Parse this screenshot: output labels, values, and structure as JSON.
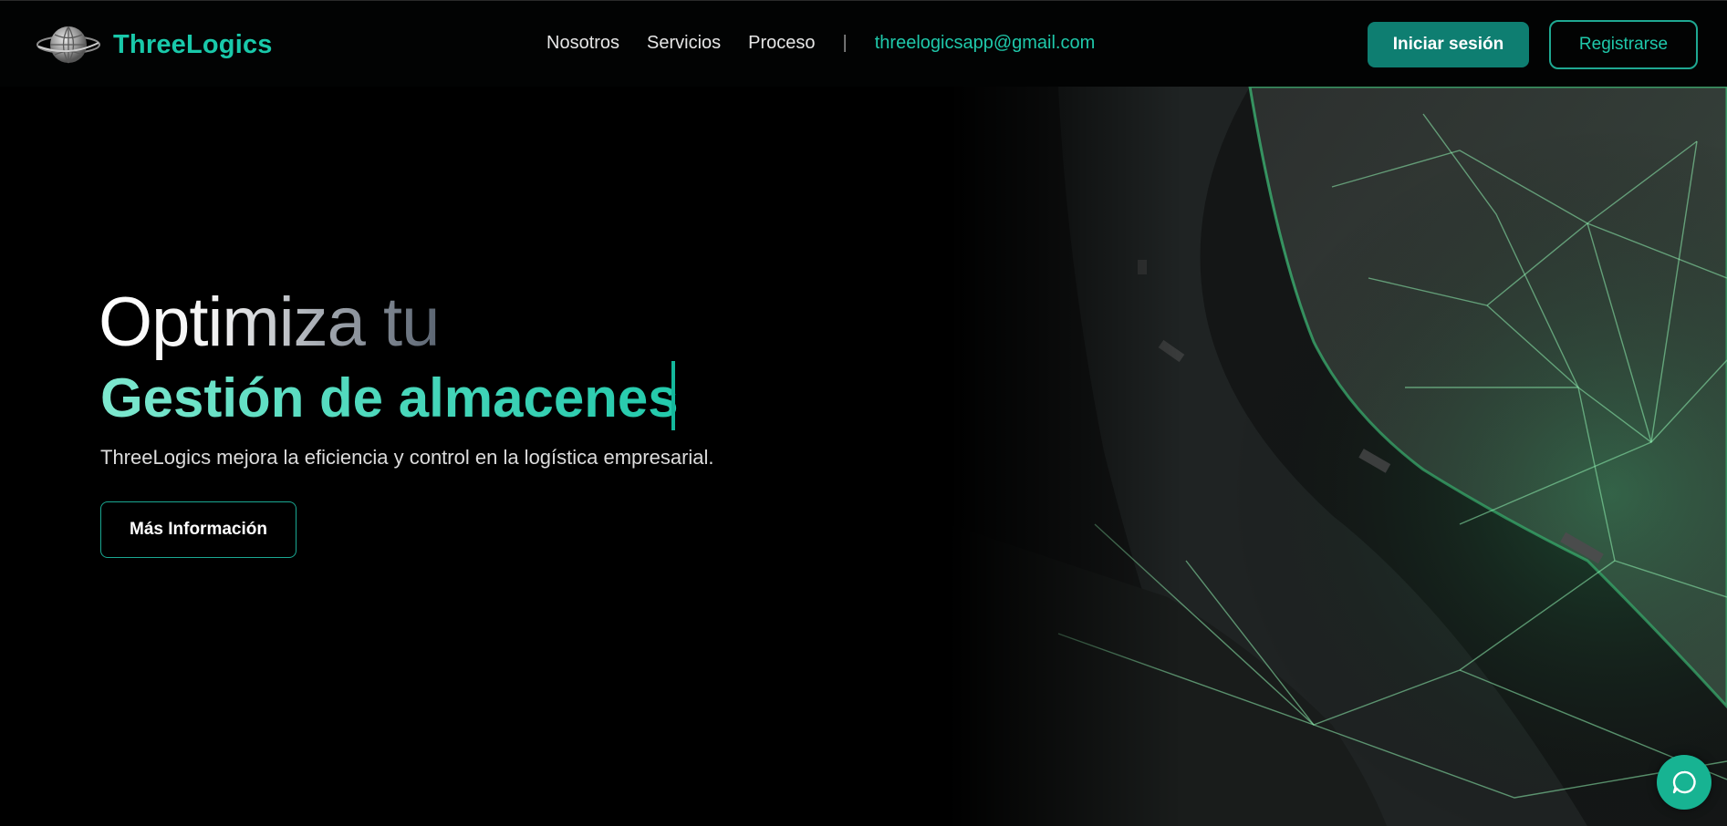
{
  "brand": {
    "name": "ThreeLogics",
    "logo_icon": "globe-logo-icon"
  },
  "nav": {
    "items": [
      {
        "label": "Nosotros"
      },
      {
        "label": "Servicios"
      },
      {
        "label": "Proceso"
      }
    ],
    "separator": "|",
    "email": "threelogicsapp@gmail.com"
  },
  "auth": {
    "login_label": "Iniciar sesión",
    "register_label": "Registrarse"
  },
  "hero": {
    "title_line1": "Optimiza tu",
    "title_line2": "Gestión de almacenes",
    "subtitle": "ThreeLogics mejora la eficiencia y control en la logística empresarial.",
    "cta_label": "Más Información"
  },
  "chat": {
    "icon": "chat-bubble-icon"
  },
  "colors": {
    "accent": "#1fc8aa",
    "button_fill": "#0e7e71",
    "background": "#000000"
  }
}
